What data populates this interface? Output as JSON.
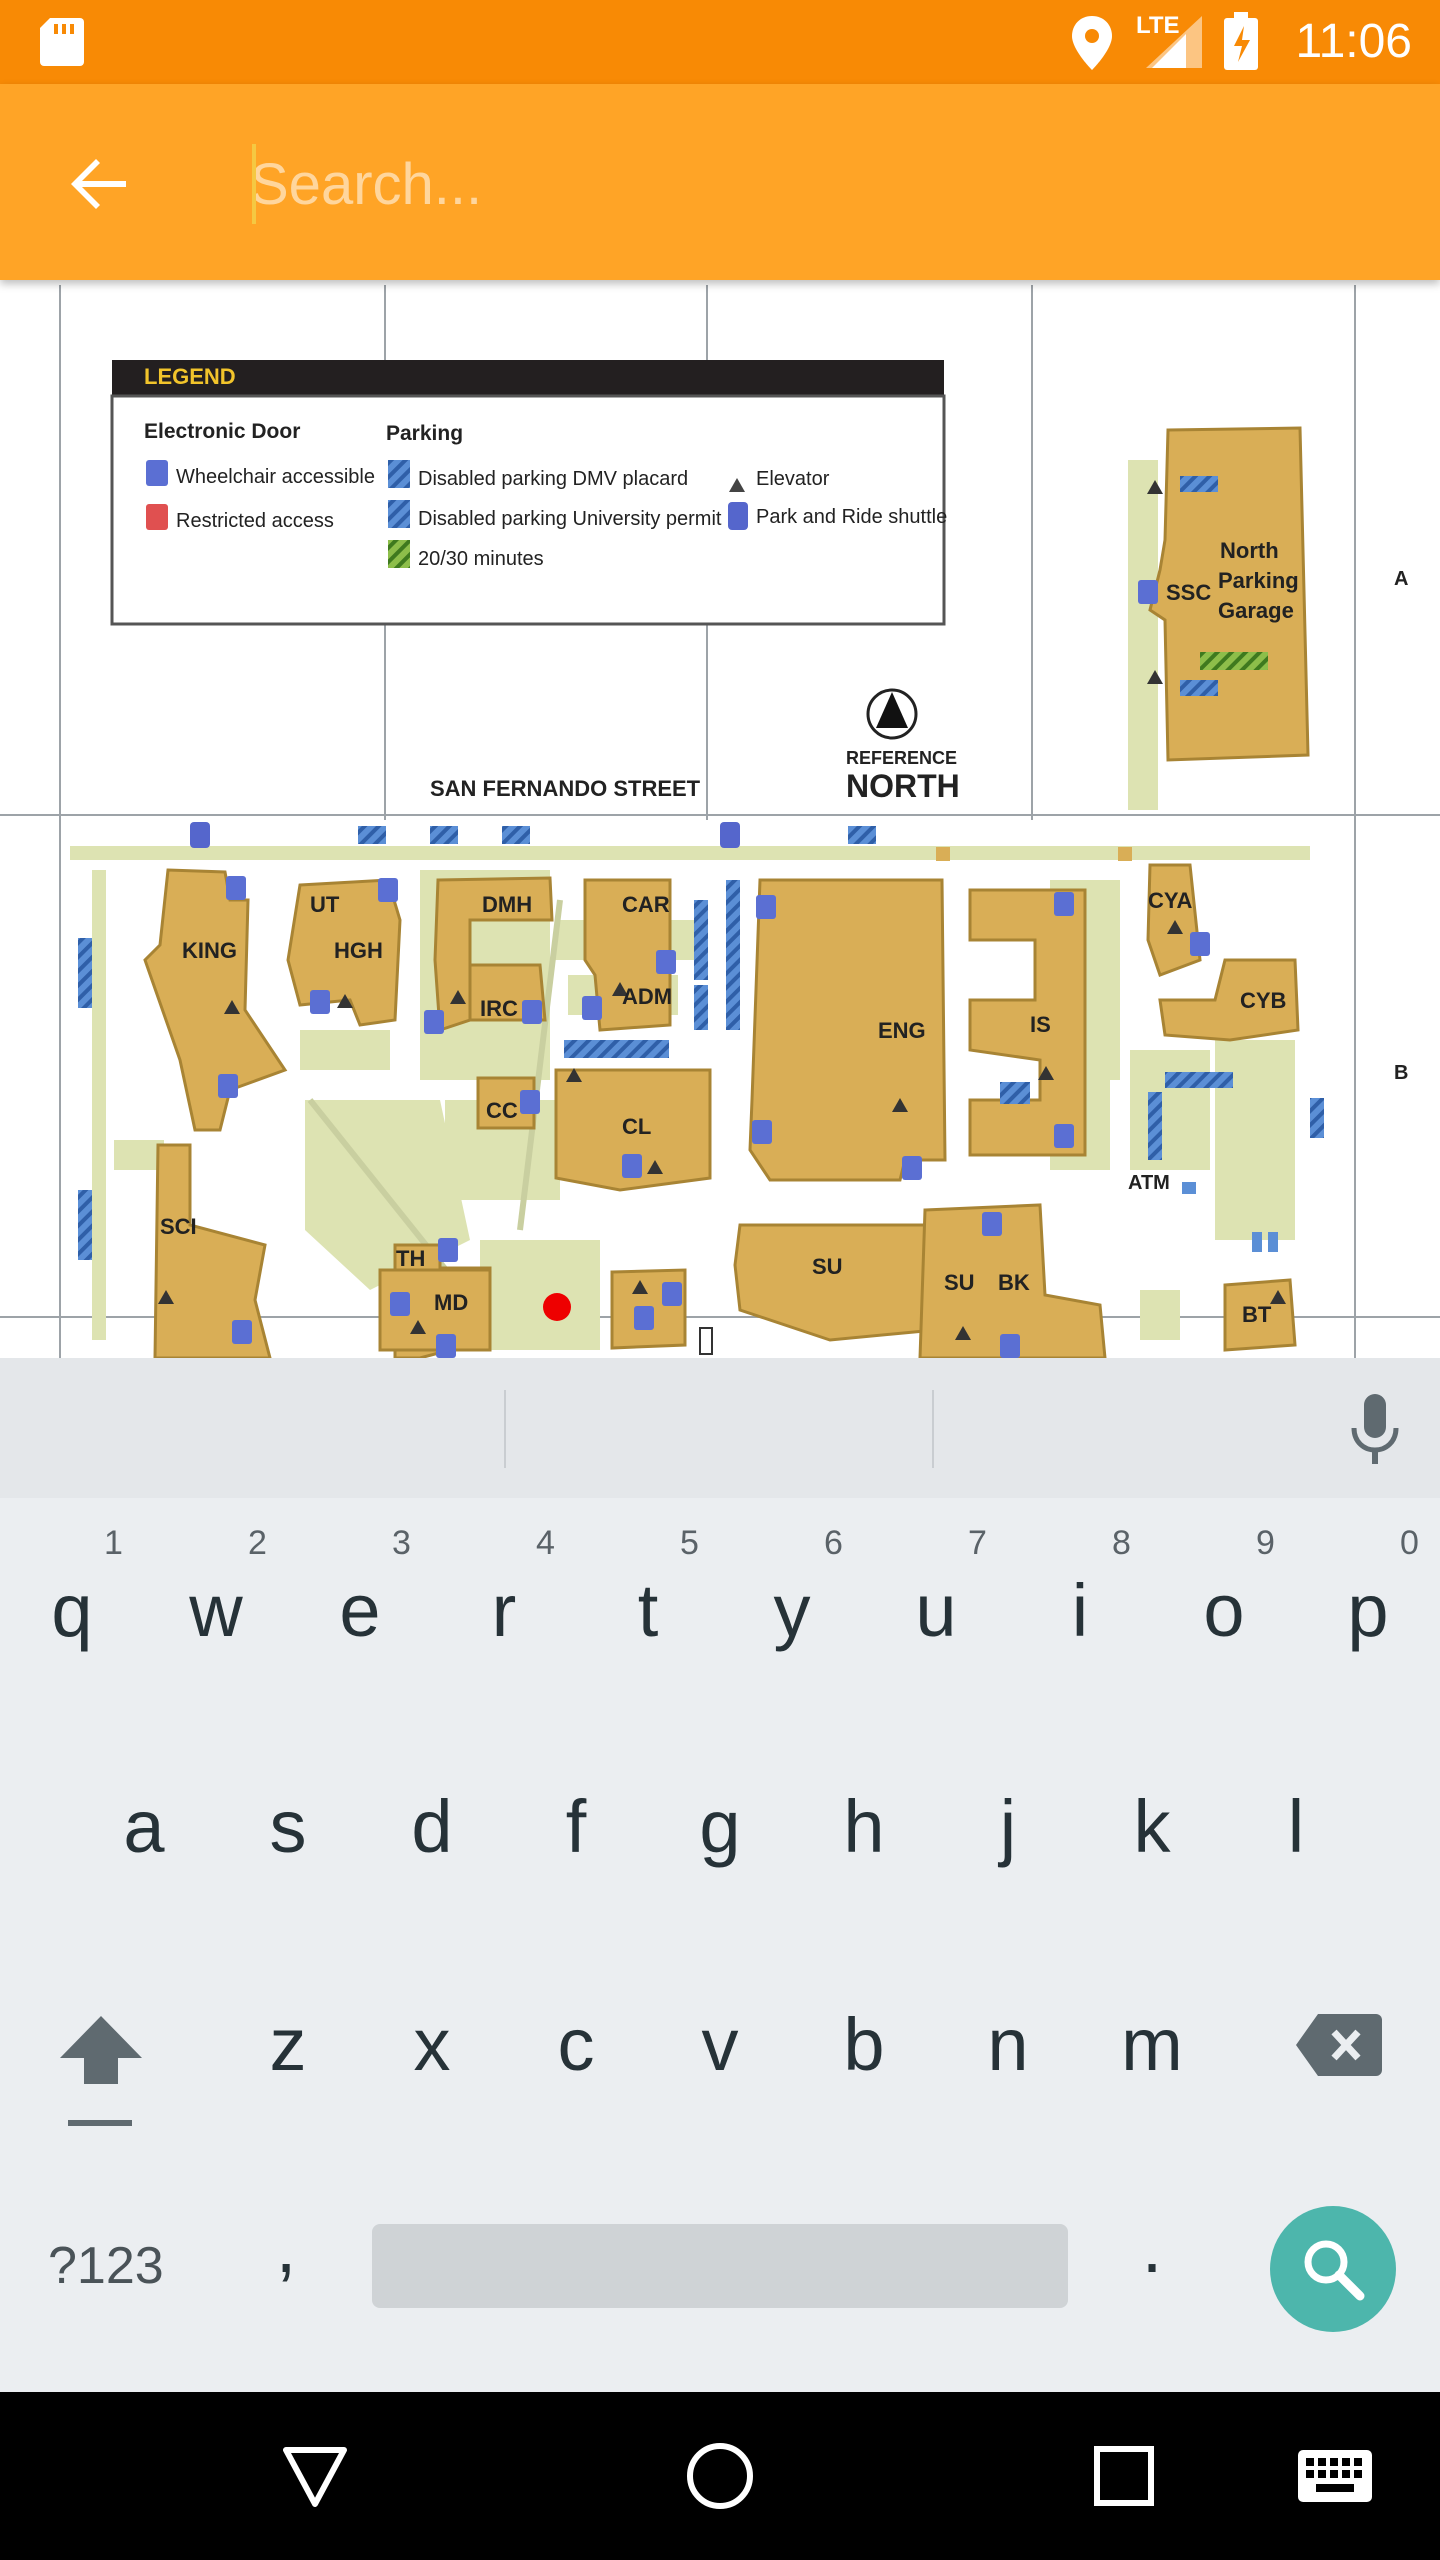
{
  "status_bar": {
    "time": "11:06",
    "network": "LTE",
    "colors": {
      "background": "#F88A05"
    }
  },
  "app_bar": {
    "search_placeholder": "Search...",
    "back_icon": "arrow-back-icon",
    "colors": {
      "background": "#FFA426"
    }
  },
  "map": {
    "legend": {
      "title": "LEGEND",
      "electronic_door_heading": "Electronic Door",
      "wheelchair": "Wheelchair accessible",
      "restricted": "Restricted access",
      "parking_heading": "Parking",
      "dmv": "Disabled parking DMV placard",
      "univ": "Disabled parking University permit",
      "minutes": "20/30 minutes",
      "elevator": "Elevator",
      "shuttle": "Park and Ride shuttle"
    },
    "north": {
      "line1": "REFERENCE",
      "line2": "NORTH"
    },
    "street": "SAN FERNANDO STREET",
    "grid_rows": [
      "A",
      "B"
    ],
    "atm": "ATM",
    "buildings": {
      "king": "KING",
      "ut": "UT",
      "hgh": "HGH",
      "dmh": "DMH",
      "car": "CAR",
      "adm": "ADM",
      "irc": "IRC",
      "cc": "CC",
      "cl": "CL",
      "eng": "ENG",
      "is": "IS",
      "cya": "CYA",
      "cyb": "CYB",
      "ssc": "SSC",
      "npg1": "North",
      "npg2": "Parking",
      "npg3": "Garage",
      "sci": "SCI",
      "th": "TH",
      "md": "MD",
      "su": "SU",
      "su2": "SU",
      "bk": "BK",
      "bt": "BT"
    },
    "colors": {
      "building": "#D9AE56",
      "green": "#DDE3B2",
      "pin": "#EE0000",
      "parking": "#5B8FD6"
    }
  },
  "keyboard": {
    "row1": [
      "q",
      "w",
      "e",
      "r",
      "t",
      "y",
      "u",
      "i",
      "o",
      "p"
    ],
    "row1_numbers": [
      "1",
      "2",
      "3",
      "4",
      "5",
      "6",
      "7",
      "8",
      "9",
      "0"
    ],
    "row2": [
      "a",
      "s",
      "d",
      "f",
      "g",
      "h",
      "j",
      "k",
      "l"
    ],
    "row3": [
      "z",
      "x",
      "c",
      "v",
      "b",
      "n",
      "m"
    ],
    "symbols_key": "?123",
    "comma": ",",
    "period": ".",
    "icons": [
      "microphone-icon",
      "shift-icon",
      "backspace-icon",
      "search-icon"
    ]
  },
  "nav_bar": {
    "icons": [
      "back-triangle-icon",
      "home-circle-icon",
      "recents-square-icon",
      "keyboard-icon"
    ]
  }
}
